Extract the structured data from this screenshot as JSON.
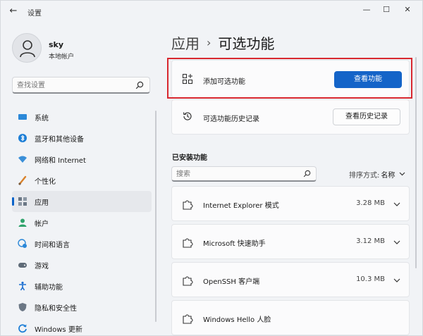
{
  "window": {
    "title": "设置",
    "minimize_glyph": "—",
    "maximize_glyph": "☐",
    "close_glyph": "✕",
    "back_glyph": "←"
  },
  "user": {
    "name": "sky",
    "account_type": "本地帐户"
  },
  "search": {
    "placeholder": "查找设置"
  },
  "sidebar": {
    "items": [
      {
        "label": "系统",
        "icon": "system-icon",
        "color": "#2b88d8"
      },
      {
        "label": "蓝牙和其他设备",
        "icon": "bluetooth-icon",
        "color": "#1c7ed6"
      },
      {
        "label": "网络和 Internet",
        "icon": "network-icon",
        "color": "#3a8fd8"
      },
      {
        "label": "个性化",
        "icon": "brush-icon",
        "color": "#d9822b"
      },
      {
        "label": "应用",
        "icon": "apps-icon",
        "color": "#6b7785",
        "active": true
      },
      {
        "label": "帐户",
        "icon": "account-icon",
        "color": "#2fa36b"
      },
      {
        "label": "时间和语言",
        "icon": "globe-clock-icon",
        "color": "#2b88d8"
      },
      {
        "label": "游戏",
        "icon": "gamepad-icon",
        "color": "#5f6b78"
      },
      {
        "label": "辅助功能",
        "icon": "accessibility-icon",
        "color": "#1c6fd1"
      },
      {
        "label": "隐私和安全性",
        "icon": "shield-icon",
        "color": "#6b7785"
      },
      {
        "label": "Windows 更新",
        "icon": "update-icon",
        "color": "#1c7ed6"
      }
    ]
  },
  "breadcrumb": {
    "parent": "应用",
    "separator": "›",
    "current": "可选功能"
  },
  "add_card": {
    "label": "添加可选功能",
    "button": "查看功能"
  },
  "history_card": {
    "label": "可选功能历史记录",
    "button": "查看历史记录"
  },
  "installed": {
    "title": "已安装功能",
    "search_placeholder": "搜索",
    "sort_label": "排序方式:",
    "sort_value": "名称",
    "features": [
      {
        "name": "Internet Explorer 模式",
        "size": "3.28 MB"
      },
      {
        "name": "Microsoft 快速助手",
        "size": "3.12 MB"
      },
      {
        "name": "OpenSSH 客户端",
        "size": "10.3 MB"
      },
      {
        "name": "Windows Hello 人脸",
        "size": ""
      }
    ]
  },
  "colors": {
    "accent": "#1464c8",
    "highlight": "#d8282f"
  }
}
